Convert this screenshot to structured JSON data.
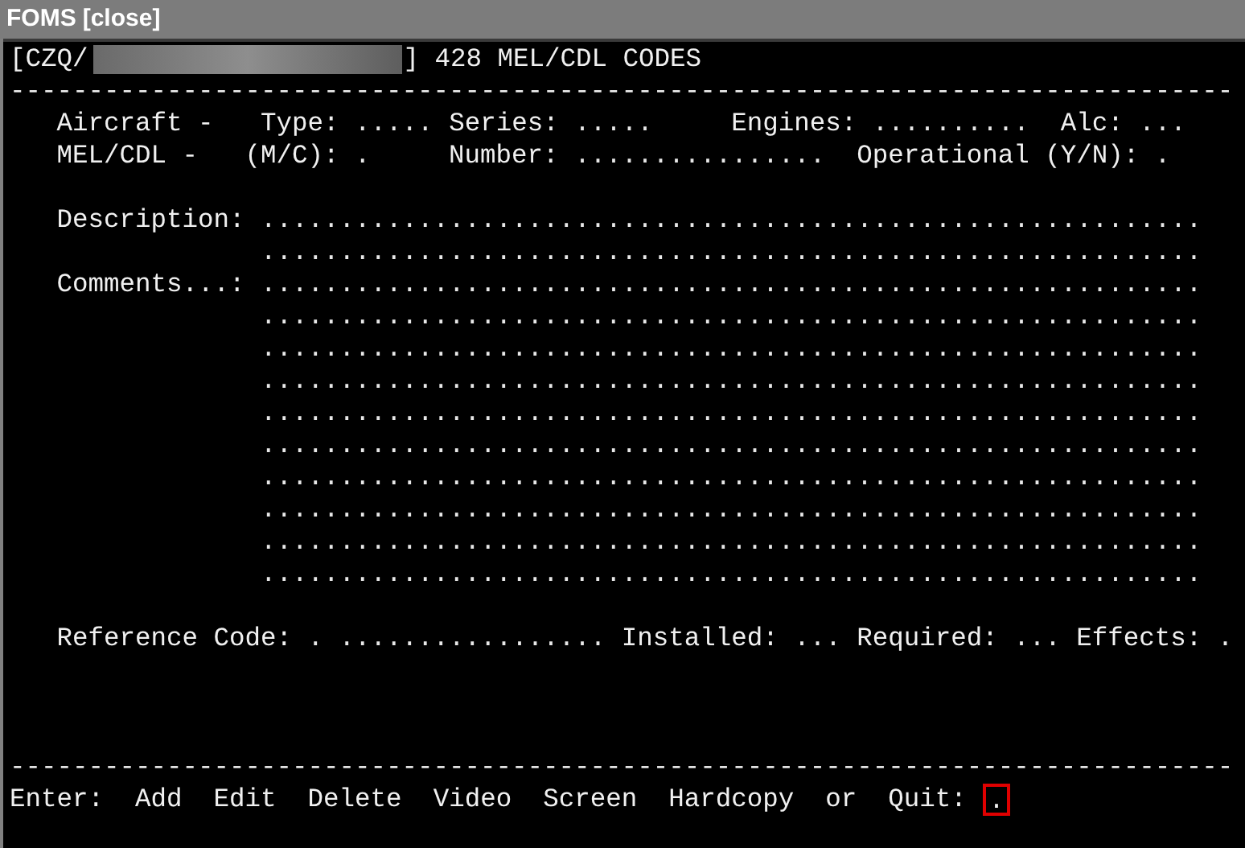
{
  "window": {
    "title": "FOMS",
    "close_label": "[close]"
  },
  "header": {
    "prefix": "[CZQ/",
    "suffix": "] 428 MEL/CDL CODES"
  },
  "separator_top": "------------------------------------------------------------------------------",
  "lines": [
    {
      "segments": [
        {
          "kind": "label",
          "text": "Aircraft -"
        },
        {
          "kind": "label",
          "text": "Type:"
        },
        {
          "kind": "field",
          "text": "....."
        },
        {
          "kind": "label",
          "text": "Series:"
        },
        {
          "kind": "field",
          "text": "....."
        },
        {
          "kind": "label",
          "text": "Engines:"
        },
        {
          "kind": "field",
          "text": ".........."
        },
        {
          "kind": "label",
          "text": "Alc:"
        },
        {
          "kind": "field",
          "text": "..."
        }
      ]
    },
    {
      "segments": [
        {
          "kind": "label",
          "text": "MEL/CDL -"
        },
        {
          "kind": "label",
          "text": "(M/C):"
        },
        {
          "kind": "field",
          "text": "."
        },
        {
          "kind": "label",
          "text": "Number:"
        },
        {
          "kind": "field",
          "text": "................"
        },
        {
          "kind": "label",
          "text": "Operational (Y/N):"
        },
        {
          "kind": "field",
          "text": "."
        }
      ]
    },
    {
      "segments": [
        {
          "kind": "label",
          "text": "Description:"
        },
        {
          "kind": "field",
          "text": "............................................................"
        }
      ]
    },
    {
      "segments": [
        {
          "kind": "field",
          "text": "............................................................"
        }
      ]
    },
    {
      "segments": [
        {
          "kind": "label",
          "text": "Comments...:"
        },
        {
          "kind": "field",
          "text": "............................................................"
        }
      ]
    },
    {
      "segments": [
        {
          "kind": "field",
          "text": "............................................................"
        }
      ]
    },
    {
      "segments": [
        {
          "kind": "field",
          "text": "............................................................"
        }
      ]
    },
    {
      "segments": [
        {
          "kind": "field",
          "text": "............................................................"
        }
      ]
    },
    {
      "segments": [
        {
          "kind": "field",
          "text": "............................................................"
        }
      ]
    },
    {
      "segments": [
        {
          "kind": "field",
          "text": "............................................................"
        }
      ]
    },
    {
      "segments": [
        {
          "kind": "field",
          "text": "............................................................"
        }
      ]
    },
    {
      "segments": [
        {
          "kind": "field",
          "text": "............................................................"
        }
      ]
    },
    {
      "segments": [
        {
          "kind": "field",
          "text": "............................................................"
        }
      ]
    },
    {
      "segments": [
        {
          "kind": "field",
          "text": "............................................................"
        }
      ]
    },
    {
      "segments": [
        {
          "kind": "label",
          "text": "Reference Code:"
        },
        {
          "kind": "field",
          "text": "."
        },
        {
          "kind": "field",
          "text": "................."
        },
        {
          "kind": "label",
          "text": "Installed:"
        },
        {
          "kind": "field",
          "text": "..."
        },
        {
          "kind": "label",
          "text": "Required:"
        },
        {
          "kind": "field",
          "text": "..."
        },
        {
          "kind": "label",
          "text": "Effects:"
        },
        {
          "kind": "field",
          "text": "."
        }
      ]
    }
  ],
  "separator_bottom": "------------------------------------------------------------------------------",
  "footer": {
    "prompt": "Enter:",
    "commands": [
      "Add",
      "Edit",
      "Delete",
      "Video",
      "Screen",
      "Hardcopy"
    ],
    "conjunction": "or",
    "quit": "Quit:",
    "input": {
      "value": ".",
      "highlighted": true
    }
  }
}
